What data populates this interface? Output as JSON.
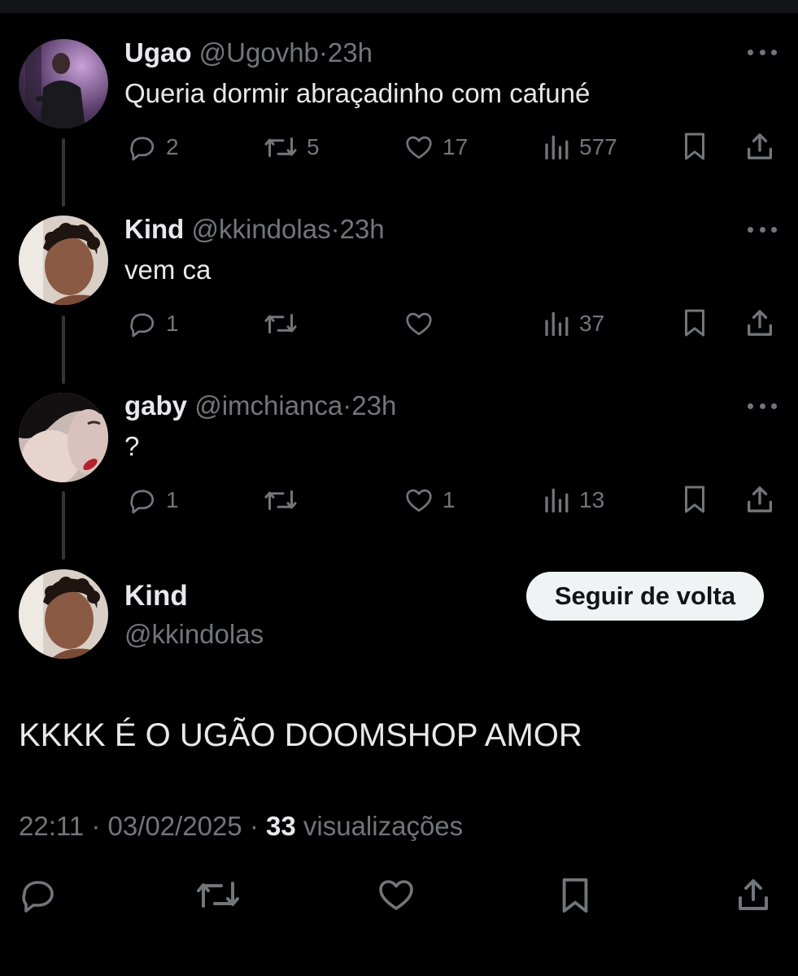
{
  "thread": [
    {
      "name": "Ugao",
      "handle": "@Ugovhb",
      "separator": "·",
      "time": "23h",
      "text": "Queria dormir abraçadinho com cafuné",
      "replies": "2",
      "reposts": "5",
      "likes": "17",
      "views": "577",
      "avatar_icon": "user-photo"
    },
    {
      "name": "Kind",
      "handle": "@kkindolas",
      "separator": "·",
      "time": "23h",
      "text": "vem ca",
      "replies": "1",
      "reposts": "",
      "likes": "",
      "views": "37",
      "avatar_icon": "user-photo"
    },
    {
      "name": "gaby",
      "handle": "@imchianca",
      "separator": "·",
      "time": "23h",
      "text": "?",
      "replies": "1",
      "reposts": "",
      "likes": "1",
      "views": "13",
      "avatar_icon": "user-photo"
    }
  ],
  "main_post": {
    "name": "Kind",
    "handle": "@kkindolas",
    "follow_label": "Seguir de volta",
    "text": "KKKK É O UGÃO DOOMSHOP AMOR",
    "time": "22:11",
    "sep1": "·",
    "date": "03/02/2025",
    "sep2": "·",
    "views_count": "33",
    "views_label": "visualizações"
  },
  "icons": {
    "reply": "reply-icon",
    "repost": "repost-icon",
    "like": "heart-icon",
    "views": "views-icon",
    "bookmark": "bookmark-icon",
    "share": "share-icon",
    "more": "more-icon"
  },
  "colors": {
    "background": "#000000",
    "primary_text": "#e7e9ea",
    "secondary_text": "#71767b",
    "thread_line": "#333639",
    "button_bg": "#eff3f4",
    "button_text": "#0f1419"
  }
}
